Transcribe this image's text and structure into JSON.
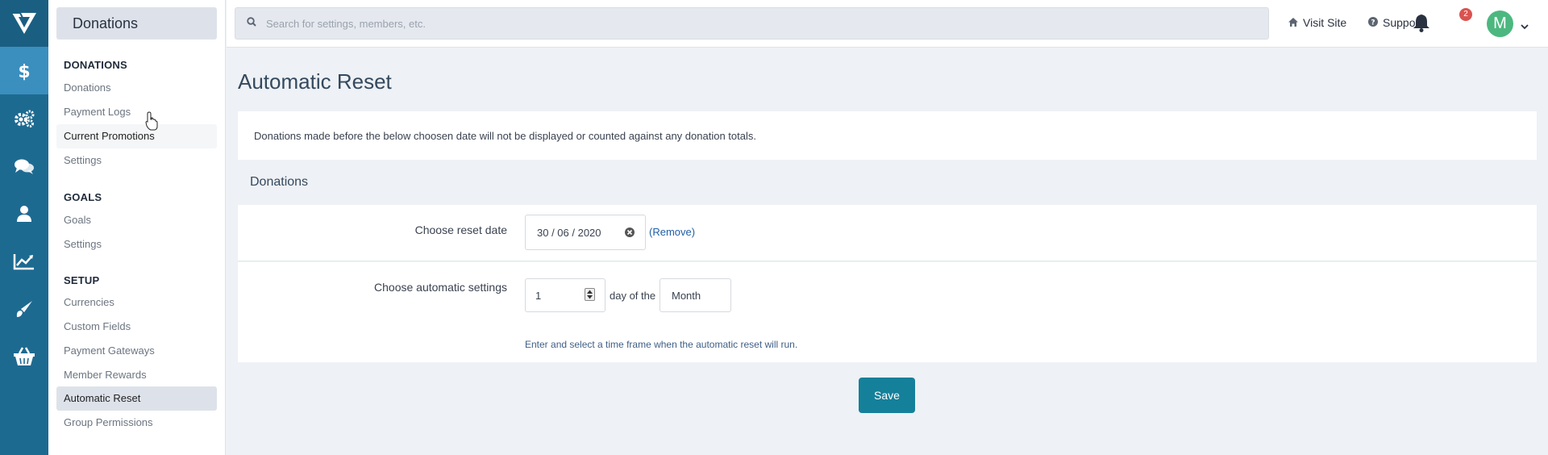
{
  "rail": {
    "items": [
      "donations-dollar",
      "settings-gears",
      "chat-bubbles",
      "members-person",
      "analytics-chart",
      "appearance-brush",
      "store-basket"
    ],
    "active": "donations-dollar",
    "colors": {
      "bg": "#1d6a91",
      "active": "#3a8fbf"
    }
  },
  "sidebar": {
    "title": "Donations",
    "sections": [
      {
        "heading": "DONATIONS",
        "items": [
          "Donations",
          "Payment Logs",
          "Current Promotions",
          "Settings"
        ]
      },
      {
        "heading": "GOALS",
        "items": [
          "Goals",
          "Settings"
        ]
      },
      {
        "heading": "SETUP",
        "items": [
          "Currencies",
          "Custom Fields",
          "Payment Gateways",
          "Member Rewards",
          "Automatic Reset",
          "Group Permissions"
        ]
      }
    ],
    "active_item": "Automatic Reset"
  },
  "topbar": {
    "search_placeholder": "Search for settings, members, etc.",
    "visit_site": "Visit Site",
    "support": "Support",
    "notification_count": "2",
    "avatar_letter": "M"
  },
  "page": {
    "title": "Automatic Reset",
    "info": "Donations made before the below choosen date will not be displayed or counted against any donation totals.",
    "panel_heading": "Donations",
    "reset_date_label": "Choose reset date",
    "reset_date_value": "30 / 06 / 2020",
    "remove_link": "(Remove)",
    "auto_label": "Choose automatic settings",
    "day_value": "1",
    "day_of_the": "day of the",
    "period_value": "Month",
    "help_text": "Enter and select a time frame when the automatic reset will run.",
    "save_label": "Save"
  },
  "colors": {
    "save": "#15809a",
    "badge": "#d9534f",
    "avatar": "#4cb880",
    "link": "#1f5fa6"
  }
}
